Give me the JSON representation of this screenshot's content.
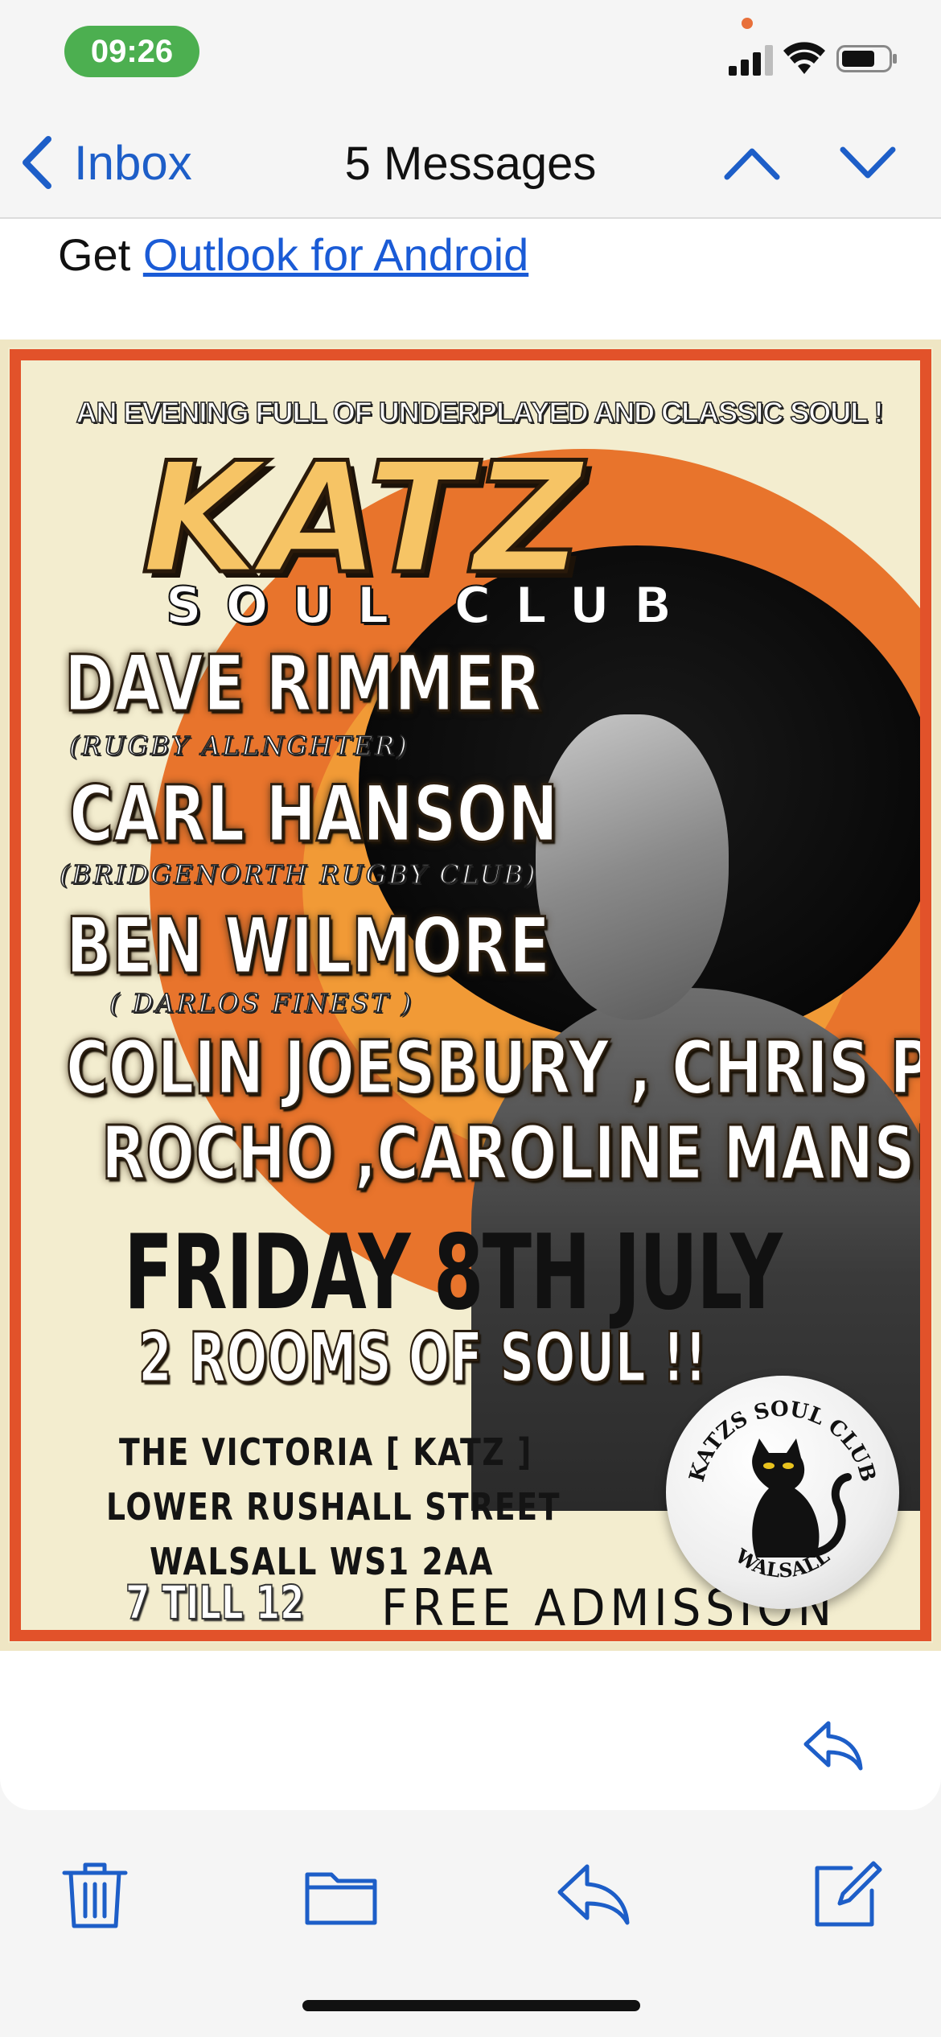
{
  "status": {
    "time": "09:26"
  },
  "nav": {
    "back_label": "Inbox",
    "title": "5 Messages"
  },
  "email": {
    "prefix": "Get",
    "link_text": "Outlook for Android"
  },
  "poster": {
    "tagline": "AN EVENING FULL OF UNDERPLAYED AND CLASSIC SOUL !",
    "headline": "KATZ",
    "subheadline": "SOUL CLUB",
    "djs": [
      {
        "name": "DAVE RIMMER",
        "sub": "(RUGBY ALLNGHTER)"
      },
      {
        "name": "CARL HANSON",
        "sub": "(BRIDGENORTH RUGBY CLUB)"
      },
      {
        "name": "BEN WILMORE",
        "sub": "( DARLOS FINEST )"
      }
    ],
    "more_djs_line1": "COLIN JOESBURY , CHRIS PRICE",
    "more_djs_line2": "ROCHO ,CAROLINE MANSELL",
    "date": "FRIDAY 8TH JULY",
    "rooms": "2 ROOMS OF SOUL !!",
    "venue_line1": "THE VICTORIA [ KATZ ]",
    "venue_line2": "LOWER RUSHALL STREET",
    "venue_line3": "WALSALL WS1 2AA",
    "hours": "7 TILL 12",
    "admission": "FREE ADMISSION",
    "badge_top": "KATZS SOUL CLUB",
    "badge_bottom": "WALSALL"
  },
  "icons": {
    "back": "chevron-left-icon",
    "up": "chevron-up-icon",
    "down": "chevron-down-icon",
    "reply": "reply-icon",
    "trash": "trash-icon",
    "folder": "folder-icon",
    "compose": "compose-icon"
  },
  "colors": {
    "accent": "#1d5ec8",
    "time_pill": "#4caf50",
    "poster_border": "#e2522a"
  }
}
